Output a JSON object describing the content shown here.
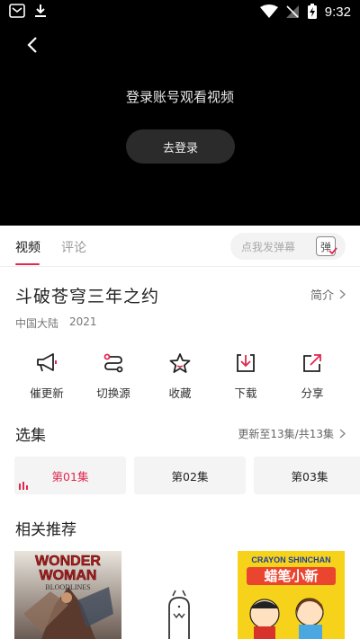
{
  "status_bar": {
    "time": "9:32"
  },
  "player": {
    "login_prompt": "登录账号观看视频",
    "login_button": "去登录"
  },
  "tabs": [
    {
      "label": "视频",
      "active": true
    },
    {
      "label": "评论",
      "active": false
    }
  ],
  "danmu": {
    "placeholder": "点我发弹幕",
    "icon_text": "弹"
  },
  "show": {
    "title": "斗破苍穹三年之约",
    "intro_label": "简介",
    "region": "中国大陆",
    "year": "2021"
  },
  "actions": [
    {
      "label": "催更新",
      "icon": "megaphone-icon"
    },
    {
      "label": "切换源",
      "icon": "switch-source-icon"
    },
    {
      "label": "收藏",
      "icon": "star-icon"
    },
    {
      "label": "下载",
      "icon": "download-icon"
    },
    {
      "label": "分享",
      "icon": "share-icon"
    }
  ],
  "episodes": {
    "header": "选集",
    "status": "更新至13集/共13集",
    "items": [
      {
        "label": "第01集",
        "active": true
      },
      {
        "label": "第02集",
        "active": false
      },
      {
        "label": "第03集",
        "active": false
      }
    ]
  },
  "recommend": {
    "header": "相关推荐",
    "posters": [
      {
        "title_line1": "WONDER",
        "title_line2": "WOMAN",
        "subtitle": "BLOODLINES"
      },
      {
        "placeholder": true
      },
      {
        "title_line1": "CRAYON SHINCHAN",
        "title_line2": "蜡笔小新"
      }
    ]
  },
  "colors": {
    "accent": "#e0284f",
    "player_bg": "#000000"
  }
}
